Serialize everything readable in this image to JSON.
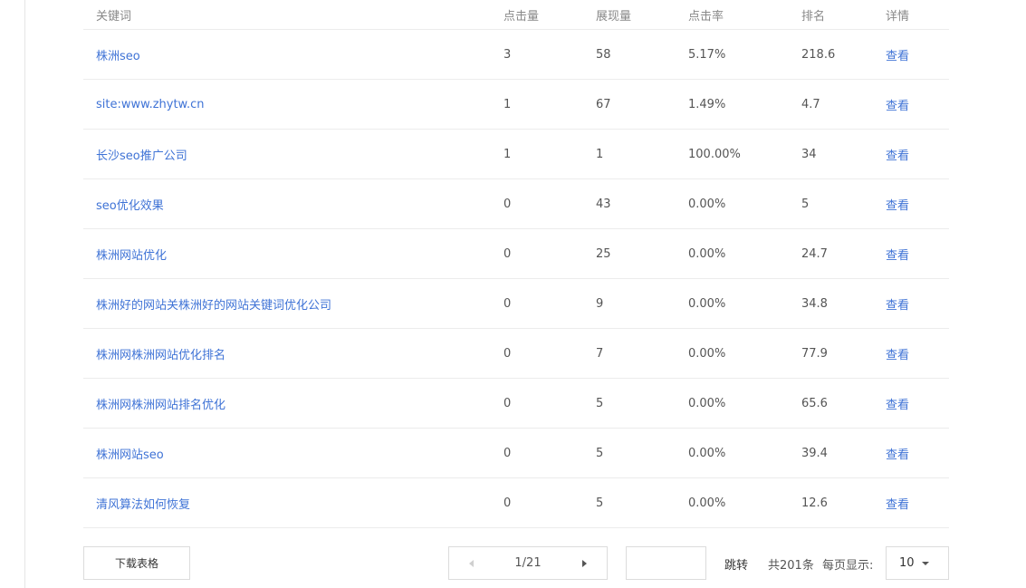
{
  "table": {
    "headers": {
      "keyword": "关键词",
      "clicks": "点击量",
      "impressions": "展现量",
      "ctr": "点击率",
      "rank": "排名",
      "detail": "详情"
    },
    "rows": [
      {
        "keyword": "株洲seo",
        "clicks": "3",
        "impressions": "58",
        "ctr": "5.17%",
        "rank": "218.6",
        "detail": "查看"
      },
      {
        "keyword": "site:www.zhytw.cn",
        "clicks": "1",
        "impressions": "67",
        "ctr": "1.49%",
        "rank": "4.7",
        "detail": "查看"
      },
      {
        "keyword": "长沙seo推广公司",
        "clicks": "1",
        "impressions": "1",
        "ctr": "100.00%",
        "rank": "34",
        "detail": "查看"
      },
      {
        "keyword": "seo优化效果",
        "clicks": "0",
        "impressions": "43",
        "ctr": "0.00%",
        "rank": "5",
        "detail": "查看"
      },
      {
        "keyword": "株洲网站优化",
        "clicks": "0",
        "impressions": "25",
        "ctr": "0.00%",
        "rank": "24.7",
        "detail": "查看"
      },
      {
        "keyword": "株洲好的网站关株洲好的网站关键词优化公司",
        "clicks": "0",
        "impressions": "9",
        "ctr": "0.00%",
        "rank": "34.8",
        "detail": "查看"
      },
      {
        "keyword": "株洲网株洲网站优化排名",
        "clicks": "0",
        "impressions": "7",
        "ctr": "0.00%",
        "rank": "77.9",
        "detail": "查看"
      },
      {
        "keyword": "株洲网株洲网站排名优化",
        "clicks": "0",
        "impressions": "5",
        "ctr": "0.00%",
        "rank": "65.6",
        "detail": "查看"
      },
      {
        "keyword": "株洲网站seo",
        "clicks": "0",
        "impressions": "5",
        "ctr": "0.00%",
        "rank": "39.4",
        "detail": "查看"
      },
      {
        "keyword": "清风算法如何恢复",
        "clicks": "0",
        "impressions": "5",
        "ctr": "0.00%",
        "rank": "12.6",
        "detail": "查看"
      }
    ]
  },
  "footer": {
    "download_label": "下载表格",
    "page_indicator": "1/21",
    "jump_input_value": "",
    "jump_label": "跳转",
    "total_text": "共201条",
    "per_page_label": "每页显示:",
    "per_page_value": "10"
  },
  "colors": {
    "link": "#3f73d6",
    "text": "#555555",
    "header_text": "#888888",
    "border": "#dcdcdc"
  },
  "icons": {
    "prev": "chevron-left-icon",
    "next": "chevron-right-icon",
    "dropdown": "caret-down-icon"
  }
}
